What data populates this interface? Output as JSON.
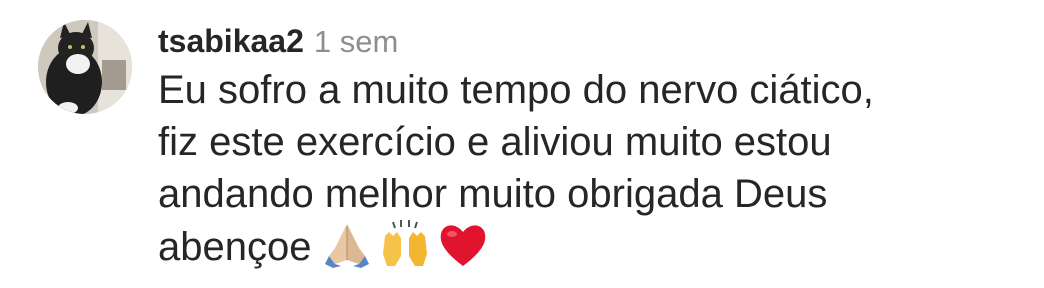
{
  "comment": {
    "avatar_icon": "cat-avatar",
    "username": "tsabikaa2",
    "timestamp": "1 sem",
    "text": "Eu sofro a muito tempo  do nervo ciático,\nfiz este exercício  e aliviou muito estou\nandando melhor  muito obrigada  Deus\nabençoe",
    "emojis": [
      "folded-hands-icon",
      "raising-hands-icon",
      "red-heart-icon"
    ]
  },
  "colors": {
    "username": "#262626",
    "timestamp": "#8e8e8e",
    "heart": "#e0142e"
  }
}
